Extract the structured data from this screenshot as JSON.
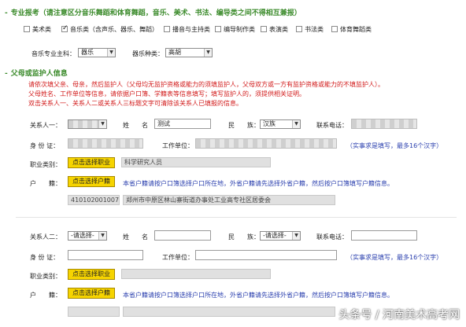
{
  "sec1": {
    "title": "专业报考（请注意区分音乐舞蹈和体育舞蹈，音乐、美术、书法、编导类之间不得相互兼报）",
    "options": [
      {
        "label": "美术类",
        "checked": false
      },
      {
        "label": "音乐类（含声乐、器乐、舞蹈）",
        "checked": true
      },
      {
        "label": "播音与主持类",
        "checked": false
      },
      {
        "label": "编导制作类",
        "checked": false
      },
      {
        "label": "表演类",
        "checked": false
      },
      {
        "label": "书法类",
        "checked": false
      },
      {
        "label": "体育舞蹈类",
        "checked": false
      }
    ],
    "major_label": "音乐专业主科：",
    "major_value": "器乐",
    "instrument_label": "器乐种类：",
    "instrument_value": "高胡"
  },
  "sec2": {
    "title": "父母或监护人信息",
    "notes": [
      "请依次填父亲、母亲，然后监护人（父母均无监护资格或能力的须填监护人，父母双方或一方有监护资格或能力的不填监护人）。",
      "父母姓名、工作单位等信息，请依据户口簿、学籍表等信息填写；填写监护人的，须提供相关证明。",
      "双击关系人一、关系人二或关系人三标题文字可清除该关系人已填报的信息。"
    ],
    "labels": {
      "rel1": "关系人一：",
      "rel2": "关系人二：",
      "name": "姓　　名",
      "ethnic": "民　　族：",
      "phone": "联系电话：",
      "idcard": "身 份 证：",
      "workunit": "工作单位：",
      "job": "职业类别：",
      "hukou": "户　　籍："
    },
    "hint_work": "（实事求是填写，最多16个汉字）",
    "btn_job": "点击选择职业",
    "btn_hukou": "点击选择户籍",
    "hukou_hint": "本省户籍请按户口簿选择户口所在地，外省户籍请先选择外省户籍，然后按户口簿填写户籍信息。",
    "p1": {
      "relation": "",
      "name": "测试",
      "ethnic": "汉族",
      "phone": "",
      "idcard": "",
      "workunit": "",
      "job": "科学研究人员",
      "hukou_code": "410102001007",
      "hukou_text": "郑州市中原区林山寨街道办事处工业高专社区居委会"
    },
    "p2": {
      "relation": "-请选择-",
      "name": "",
      "ethnic": "-请选择-",
      "phone": "",
      "idcard": "",
      "workunit": "",
      "job": "",
      "hukou_code": "",
      "hukou_text": ""
    }
  },
  "watermark": "头条号 / 河南美术高考网"
}
